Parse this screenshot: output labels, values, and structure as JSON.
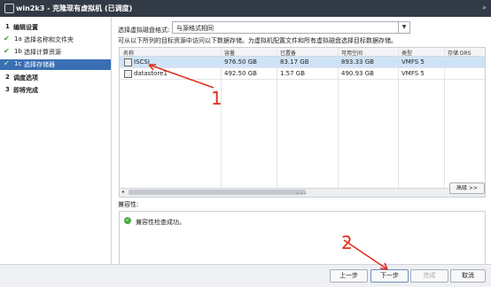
{
  "window": {
    "title": "win2k3 - 克隆现有虚拟机 (已调度)",
    "nav_arrows": "»"
  },
  "nav": {
    "steps": [
      {
        "num": "1",
        "label": "编辑设置",
        "check": ""
      },
      {
        "num": "1a",
        "label": "选择名称和文件夹",
        "check": "✔"
      },
      {
        "num": "1b",
        "label": "选择计算资源",
        "check": "✔"
      },
      {
        "num": "1c",
        "label": "选择存储器",
        "check": "✔"
      },
      {
        "num": "2",
        "label": "调度选项",
        "check": ""
      },
      {
        "num": "3",
        "label": "即将完成",
        "check": ""
      }
    ]
  },
  "disk_format": {
    "label": "选择虚拟磁盘格式:",
    "value": "与源格式相同"
  },
  "description": "可从以下所列的目标资源中访问以下数据存储。为虚拟机配置文件和所有虚拟磁盘选择目标数据存储。",
  "table": {
    "columns": [
      "名称",
      "容量",
      "已置备",
      "可用空间",
      "类型",
      "存储 DRS"
    ],
    "rows": [
      {
        "name": "ISCSI",
        "capacity": "976.50 GB",
        "provisioned": "83.17 GB",
        "free": "893.33 GB",
        "type": "VMFS 5",
        "sdrs": ""
      },
      {
        "name": "datastore1",
        "capacity": "492.50 GB",
        "provisioned": "1.57 GB",
        "free": "490.93 GB",
        "type": "VMFS 5",
        "sdrs": ""
      }
    ]
  },
  "advanced_button": "高级 >>",
  "compat": {
    "label": "兼容性:",
    "message": "兼容性检查成功。"
  },
  "footer": {
    "back": "上一步",
    "next": "下一步",
    "finish": "完成",
    "cancel": "取消"
  },
  "annotations": {
    "mark1": "1",
    "mark2": "2",
    "color": "#e0301e"
  }
}
